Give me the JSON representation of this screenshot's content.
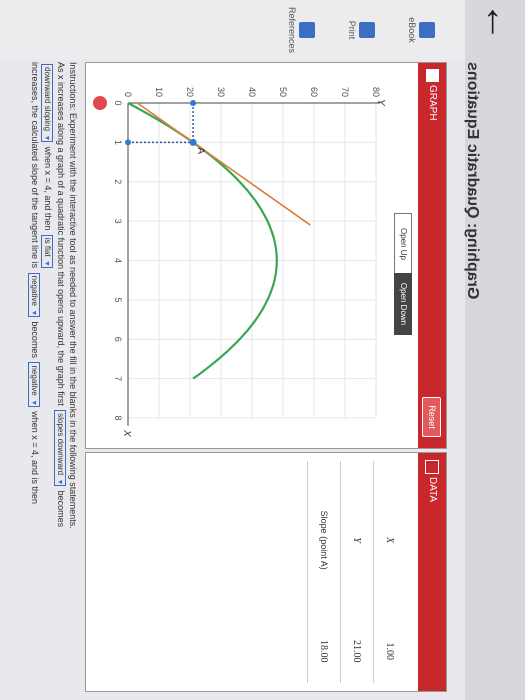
{
  "page": {
    "title": "Graphing: Quadratic Equations",
    "back_glyph": "←"
  },
  "sidebar": {
    "items": [
      {
        "label": "eBook",
        "icon": "book-icon"
      },
      {
        "label": "Print",
        "icon": "print-icon"
      },
      {
        "label": "References",
        "icon": "references-icon"
      }
    ]
  },
  "graph_panel": {
    "header": "GRAPH",
    "reset": "Reset",
    "toggle_up": "Open Up",
    "toggle_down": "Open Down",
    "y_axis_label": "Y",
    "x_axis_label": "X",
    "point_label": "A"
  },
  "data_panel": {
    "header": "DATA",
    "rows": [
      {
        "key": "X",
        "value": "1.00"
      },
      {
        "key": "Y",
        "value": "21.00"
      },
      {
        "key": "Slope (point A)",
        "value": "18.00"
      }
    ]
  },
  "instructions": {
    "text": "Instructions: Experiment with the interactive tool as needed to answer the fill in the blanks in the following statements.",
    "line2_a": "As x increases along a graph of a quadratic function that opens upward, the graph first",
    "sel_1": "slopes downward",
    "line2_b": "becomes",
    "sel_2": "downward sloping",
    "line2_c": "when x = 4, and then",
    "sel_3": "is flat",
    "line3_a": "increases, the calculated slope of the tangent line is",
    "sel_4": "negative",
    "line3_b": "becomes",
    "sel_5": "negative",
    "line3_c": "when x = 4, and is then"
  },
  "colors": {
    "header_red": "#c8272c",
    "curve_green": "#3aa655",
    "tangent_orange": "#e07a3a",
    "point_blue": "#2e7bd6",
    "drag_red": "#e0484f"
  },
  "chart_data": {
    "type": "line",
    "x": [
      0,
      1,
      2,
      3,
      4,
      5,
      6,
      7,
      8
    ],
    "series": [
      {
        "values": [
          0,
          21,
          36,
          45,
          48,
          45,
          36,
          21,
          0
        ]
      }
    ],
    "xlim": [
      0,
      8
    ],
    "ylim": [
      0,
      80
    ],
    "x_ticks": [
      0,
      1,
      2,
      3,
      4,
      5,
      6,
      7,
      8
    ],
    "y_ticks": [
      0,
      10,
      20,
      30,
      40,
      50,
      60,
      70,
      80
    ],
    "point": {
      "x": 1,
      "y": 21,
      "slope": 18
    },
    "xlabel": "X",
    "ylabel": "Y",
    "grid": true
  }
}
